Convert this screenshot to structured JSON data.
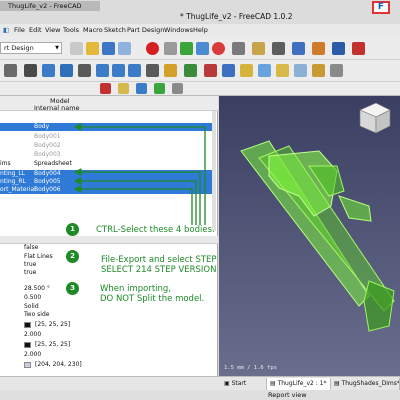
{
  "window": {
    "tab_title": "ThugLife_v2 - FreeCAD",
    "title": "* ThugLife_v2 - FreeCAD 1.0.2",
    "logo_text": "F"
  },
  "menu": [
    "File",
    "Edit",
    "View",
    "Tools",
    "Macro",
    "Sketch",
    "Part Design",
    "Windows",
    "Help"
  ],
  "toolbar": {
    "workbench_select": "rt Design"
  },
  "tree": {
    "header_title": "Model",
    "header_column": "Internal name",
    "rows": [
      {
        "label": "",
        "name": "Body",
        "selected": true,
        "dim": false
      },
      {
        "label": "",
        "name": "Body001",
        "selected": false,
        "dim": true
      },
      {
        "label": "",
        "name": "Body002",
        "selected": false,
        "dim": true
      },
      {
        "label": "",
        "name": "Body003",
        "selected": false,
        "dim": true
      },
      {
        "label": "ims",
        "name": "Spreadsheet",
        "selected": false,
        "dim": false
      },
      {
        "label": "nting_LL",
        "name": "Body004",
        "selected": true,
        "dim": false
      },
      {
        "label": "nting_RL",
        "name": "Body005",
        "selected": true,
        "dim": false
      },
      {
        "label": "ort_Material",
        "name": "Body006",
        "selected": true,
        "dim": false
      }
    ]
  },
  "properties": [
    {
      "value": "false"
    },
    {
      "value": "Flat Lines"
    },
    {
      "value": "true"
    },
    {
      "value": "true"
    },
    {
      "value": "28.500 °"
    },
    {
      "value": "0.500"
    },
    {
      "value": "Solid"
    },
    {
      "value": "Two side"
    },
    {
      "value": "[25, 25, 25]",
      "swatch": "#111111"
    },
    {
      "value": "2.000"
    },
    {
      "value": "[25, 25, 25]",
      "swatch": "#111111"
    },
    {
      "value": "2.000"
    },
    {
      "value": "[204, 204, 230]",
      "swatch": "#ccccE6"
    }
  ],
  "annotations": {
    "step1_num": "1",
    "step1_text": "CTRL-Select these 4 bodies.",
    "step2_num": "2",
    "step2_line1": "File-Export and select STEP",
    "step2_line2": "SELECT 214 STEP VERSION",
    "step3_num": "3",
    "step3_line1": "When importing,",
    "step3_line2": "DO NOT Split the model.",
    "color": "#1e8a27"
  },
  "viewport": {
    "axis_info": "1.5 mm / 1.6 fps",
    "model_color": "#7cf23c"
  },
  "tabs": [
    {
      "label": "Start",
      "active": false
    },
    {
      "label": "ThugLife_v2 : 1*",
      "active": true
    },
    {
      "label": "ThugShades_Dims*",
      "active": false
    }
  ],
  "status": {
    "report_view": "Report view"
  }
}
